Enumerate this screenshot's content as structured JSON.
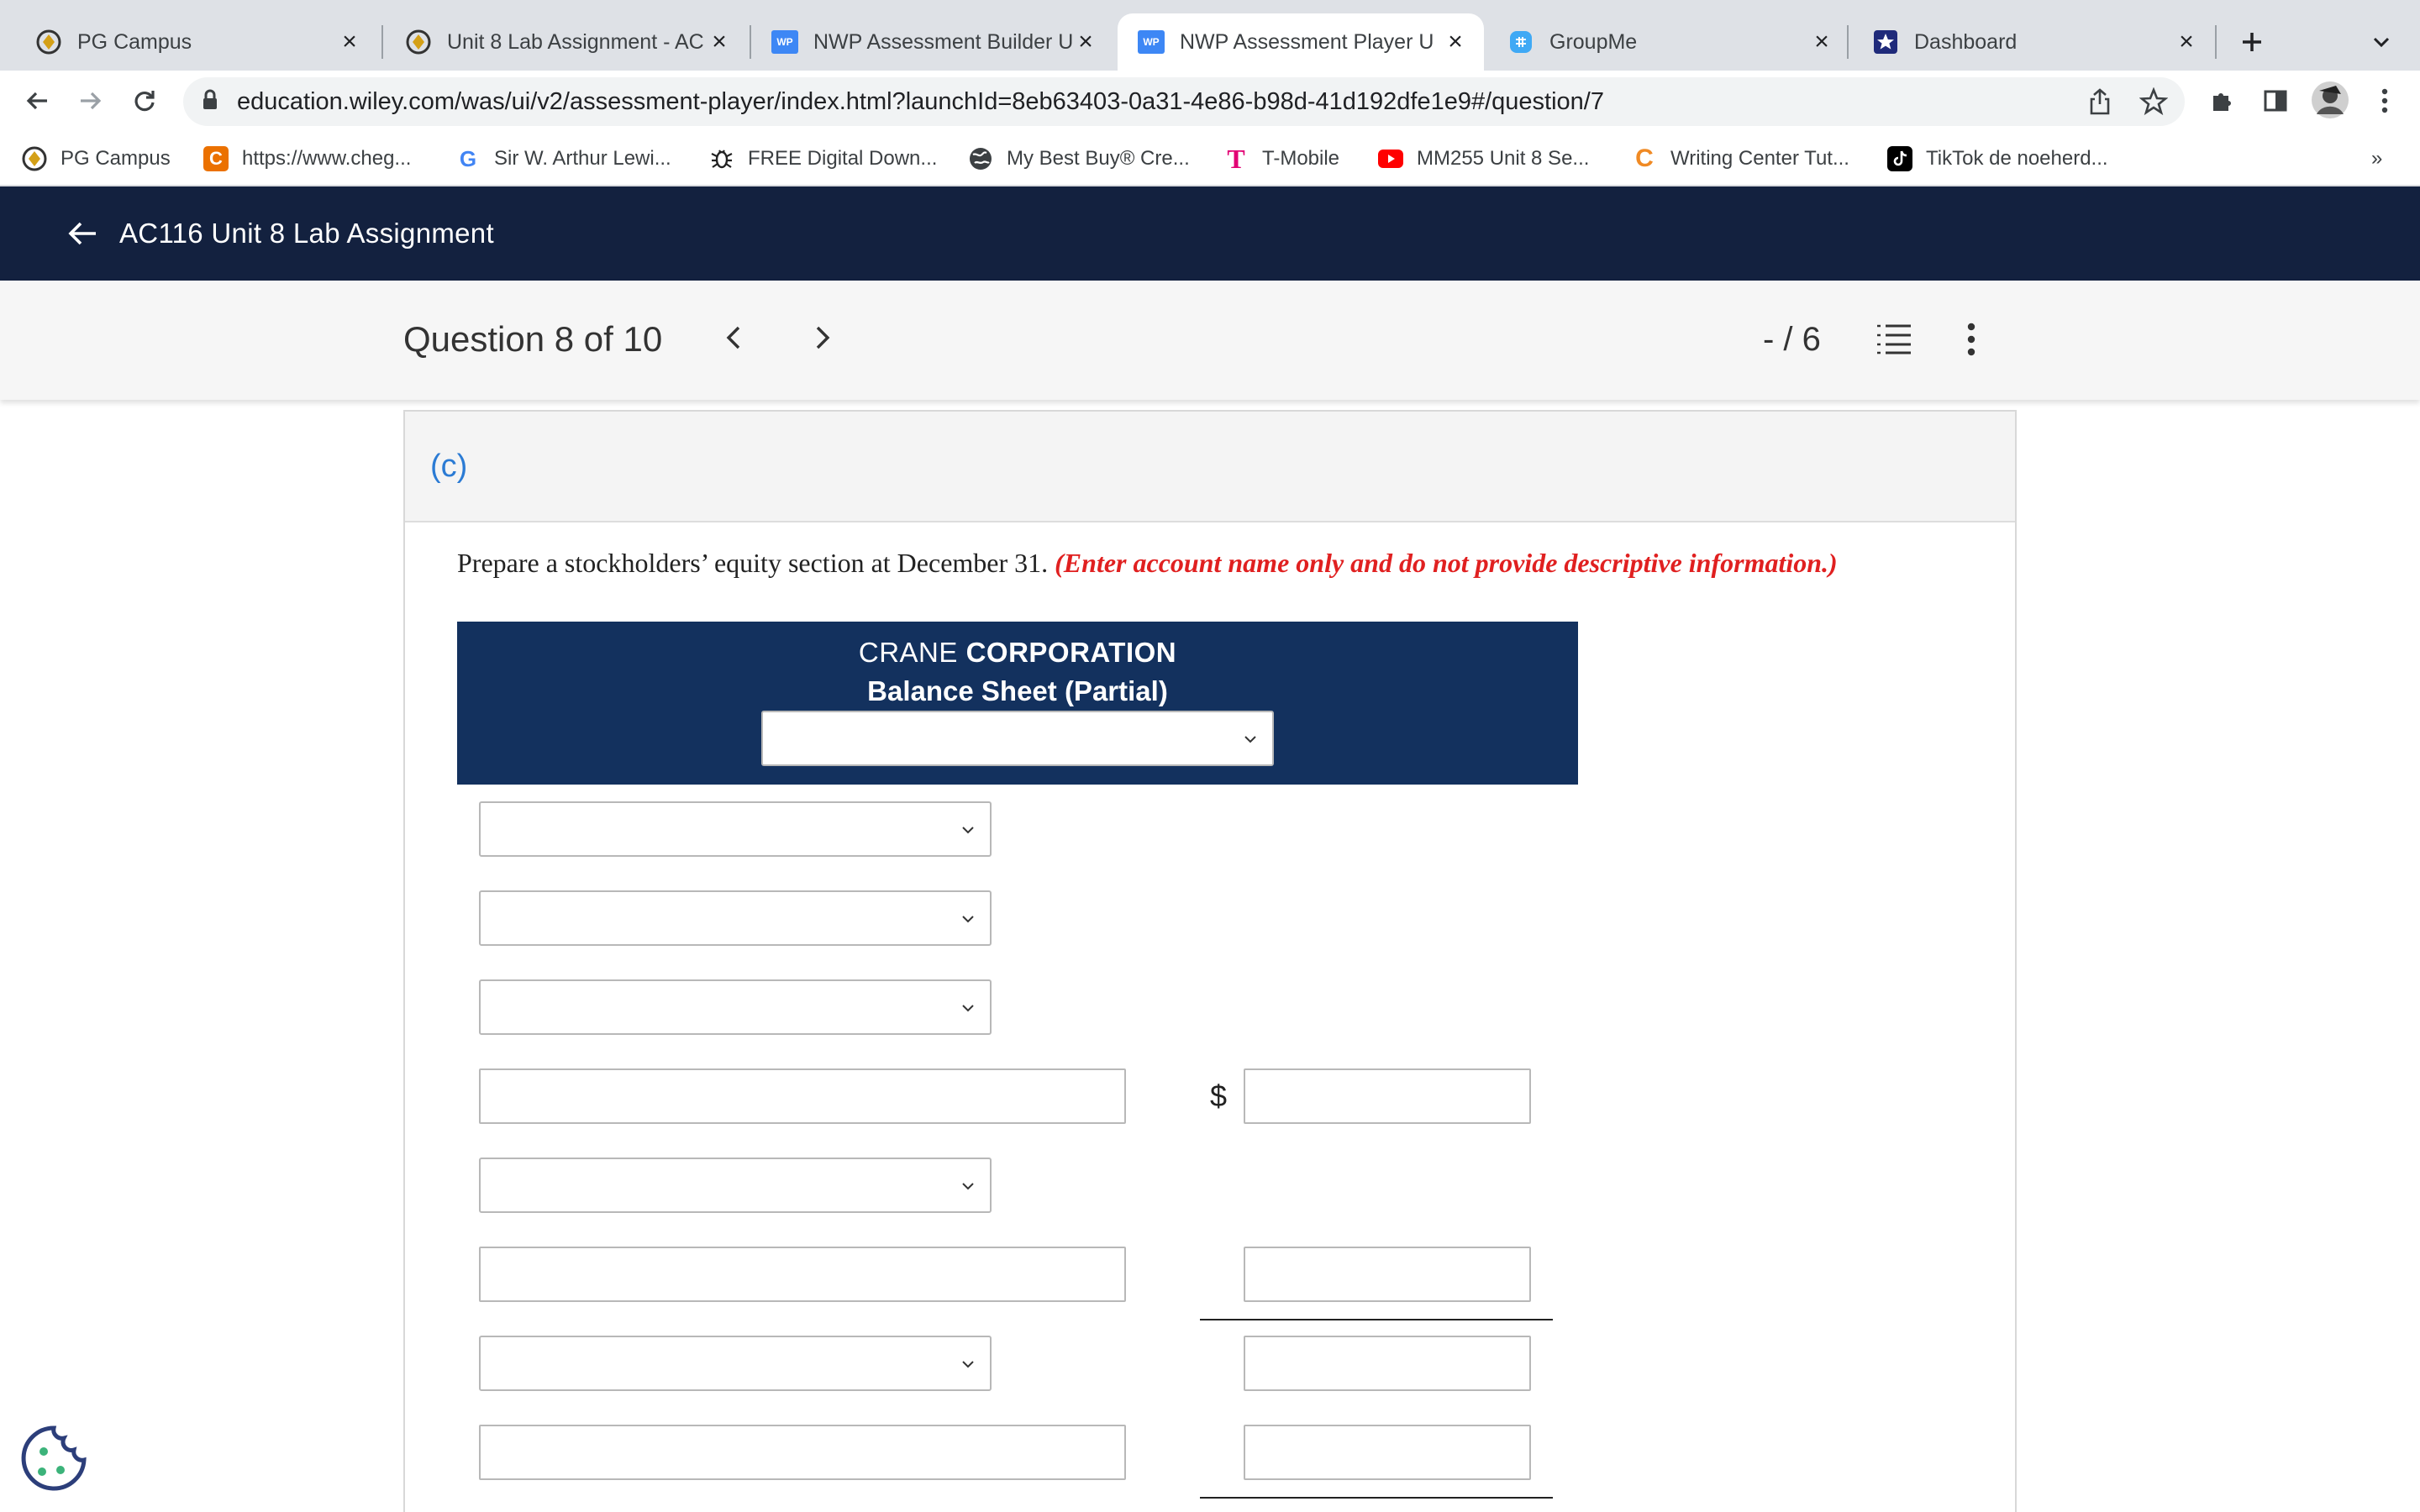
{
  "browser": {
    "tabs": [
      {
        "title": "PG Campus",
        "icon": "pg-campus-icon",
        "active": false
      },
      {
        "title": "Unit 8 Lab Assignment - AC",
        "icon": "pg-campus-icon",
        "active": false
      },
      {
        "title": "NWP Assessment Builder U",
        "icon": "wp-icon",
        "active": false
      },
      {
        "title": "NWP Assessment Player U",
        "icon": "wp-icon",
        "active": true
      },
      {
        "title": "GroupMe",
        "icon": "groupme-icon",
        "active": false
      },
      {
        "title": "Dashboard",
        "icon": "dashboard-star-icon",
        "active": false
      }
    ],
    "wp_badge": "WP",
    "url_host": "education.wiley.com",
    "url_path": "/was/ui/v2/assessment-player/index.html?launchId=8eb63403-0a31-4e86-b98d-41d192dfe1e9#/question/7",
    "bookmarks": [
      {
        "label": "PG Campus",
        "icon": "pg-campus-icon"
      },
      {
        "label": "https://www.cheg...",
        "icon": "chegg-icon",
        "glyph": "C"
      },
      {
        "label": "Sir W. Arthur Lewi...",
        "icon": "google-icon",
        "glyph": "G"
      },
      {
        "label": "FREE Digital Down...",
        "icon": "bug-icon"
      },
      {
        "label": "My Best Buy® Cre...",
        "icon": "globe-icon"
      },
      {
        "label": "T-Mobile",
        "icon": "tmobile-icon",
        "glyph": "T"
      },
      {
        "label": "MM255 Unit 8 Se...",
        "icon": "youtube-icon"
      },
      {
        "label": "Writing Center Tut...",
        "icon": "writing-center-icon",
        "glyph": "C"
      },
      {
        "label": "TikTok de noeherd...",
        "icon": "tiktok-icon"
      }
    ],
    "overflow": "»"
  },
  "app": {
    "title": "AC116 Unit 8 Lab Assignment",
    "question_label": "Question 8 of 10",
    "score": "- / 6"
  },
  "question": {
    "part": "(c)",
    "prompt": "Prepare a stockholders’ equity section at December 31.",
    "note": "(Enter account name only and do not provide descriptive information.)"
  },
  "balance_sheet": {
    "company_light": "CRANE",
    "company_bold": "CORPORATION",
    "subtitle": "Balance Sheet (Partial)",
    "currency_symbol": "$"
  },
  "colors": {
    "header_navy": "#13213f",
    "table_header_blue": "#13315e",
    "part_blue": "#2b7bd4",
    "note_red": "#e02020"
  }
}
